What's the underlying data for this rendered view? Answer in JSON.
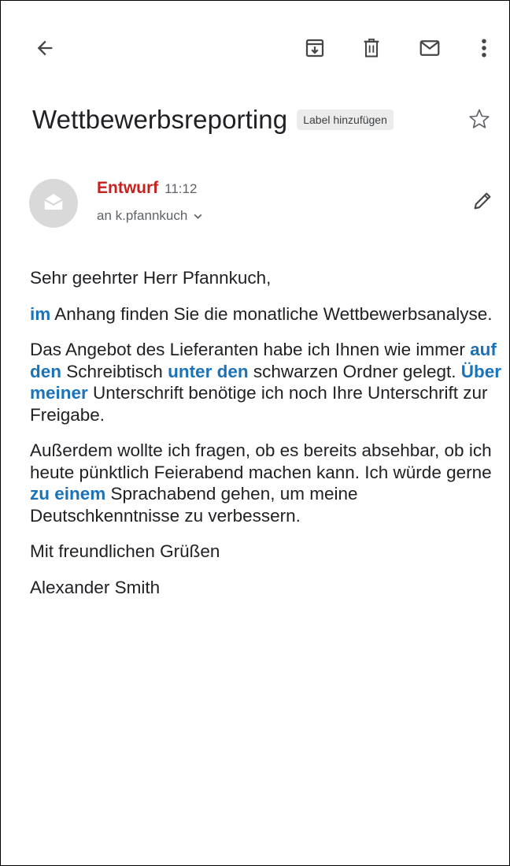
{
  "toolbar": {
    "back_icon": "arrow-left-icon",
    "archive_icon": "archive-icon",
    "delete_icon": "trash-icon",
    "unread_icon": "mail-icon",
    "more_icon": "more-vertical-icon"
  },
  "subject": {
    "title": "Wettbewerbsreporting",
    "label_chip": "Label hinzufügen",
    "star_icon": "star-outline-icon"
  },
  "message": {
    "status": "Entwurf",
    "time": "11:12",
    "recipient": "an k.pfannkuch",
    "edit_icon": "pencil-icon",
    "status_color": "#c5221f"
  },
  "body": {
    "greeting": "Sehr geehrter Herr Pfannkuch,",
    "p1": {
      "hl1": "im",
      "t1": " Anhang finden Sie die monatliche Wettbewerbsanalyse."
    },
    "p2": {
      "t1": "Das Angebot des Lieferanten habe ich Ihnen wie immer ",
      "hl1": "auf den",
      "t2": " Schreibtisch ",
      "hl2": "unter den",
      "t3": " schwarzen Ordner gelegt. ",
      "hl3": "Über meiner",
      "t4": " Unterschrift benötige ich noch Ihre Unterschrift zur Freigabe."
    },
    "p3": {
      "t1": "Außerdem wollte ich fragen, ob es bereits absehbar, ob ich heute pünktlich Feierabend machen kann. Ich würde gerne ",
      "hl1": "zu einem",
      "t2": " Sprachabend gehen, um meine Deutschkenntnisse zu verbessern."
    },
    "closing": "Mit freundlichen Grüßen",
    "signature": "Alexander Smith",
    "highlight_color": "#1a73b8"
  }
}
